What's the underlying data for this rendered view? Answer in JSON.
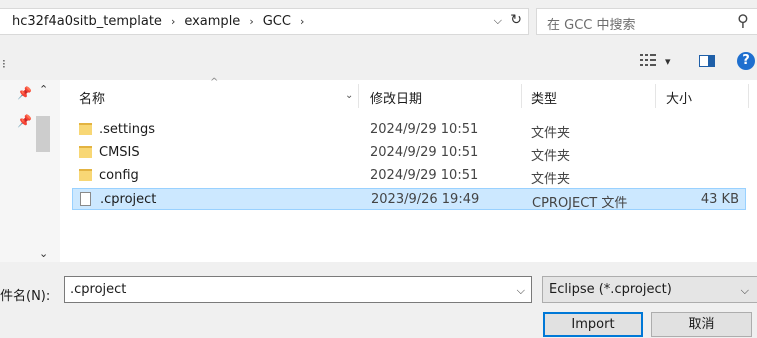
{
  "address": {
    "crumbs": [
      "hc32f4a0sitb_template",
      "example",
      "GCC"
    ],
    "separator": "›",
    "dropdown_glyph": "⌵",
    "refresh_glyph": "↻"
  },
  "search": {
    "placeholder": "在 GCC 中搜索",
    "icon": "⚲"
  },
  "toolbar": {
    "left_glyph": "⁝",
    "view_dropdown": "▾",
    "help_label": "?"
  },
  "nav": {
    "pin": "📌",
    "up": "⌃",
    "down": "⌄"
  },
  "list": {
    "columns": {
      "name": "名称",
      "modified": "修改日期",
      "type": "类型",
      "size": "大小"
    },
    "sort_caret": "^",
    "header_dropdown": "⌄",
    "rows": [
      {
        "name": ".settings",
        "modified": "2024/9/29 10:51",
        "type": "文件夹",
        "size": "",
        "kind": "folder"
      },
      {
        "name": "CMSIS",
        "modified": "2024/9/29 10:51",
        "type": "文件夹",
        "size": "",
        "kind": "folder"
      },
      {
        "name": "config",
        "modified": "2024/9/29 10:51",
        "type": "文件夹",
        "size": "",
        "kind": "folder"
      },
      {
        "name": ".cproject",
        "modified": "2023/9/26 19:49",
        "type": "CPROJECT 文件",
        "size": "43 KB",
        "kind": "file",
        "selected": true
      }
    ]
  },
  "bottom": {
    "filename_label": "件名(N):",
    "filename_value": ".cproject",
    "filter_value": "Eclipse (*.cproject)",
    "dropdown_glyph": "⌵",
    "import_label": "Import",
    "cancel_label": "取消"
  },
  "colors": {
    "selection": "#cce8ff",
    "accent": "#0078d7",
    "help": "#1e6fcf",
    "folder": "#f8d775"
  }
}
